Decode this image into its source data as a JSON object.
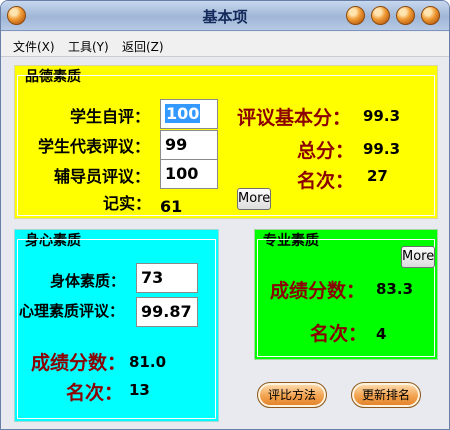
{
  "window": {
    "title": "基本项"
  },
  "menu": [
    {
      "label": "文件(X)"
    },
    {
      "label": "工具(Y)"
    },
    {
      "label": "返回(Z)"
    }
  ],
  "moral": {
    "title": "品德素质",
    "self_eval_label": "学生自评：",
    "self_eval_value": "100",
    "rep_eval_label": "学生代表评议：",
    "rep_eval_value": "99",
    "counselor_label": "辅导员评议：",
    "counselor_value": "100",
    "record_label": "记实：",
    "record_value": "61",
    "base_score_label": "评议基本分：",
    "base_score_value": "99.3",
    "total_label": "总分：",
    "total_value": "99.3",
    "rank_label": "名次：",
    "rank_value": "27",
    "more_label": "More"
  },
  "physical": {
    "title": "身心素质",
    "body_label": "身体素质：",
    "body_value": "73",
    "mental_label": "心理素质评议：",
    "mental_value": "99.87",
    "score_label": "成绩分数：",
    "score_value": "81.0",
    "rank_label": "名次：",
    "rank_value": "13"
  },
  "professional": {
    "title": "专业素质",
    "more_label": "More",
    "score_label": "成绩分数：",
    "score_value": "83.3",
    "rank_label": "名次：",
    "rank_value": "4"
  },
  "buttons": {
    "method_label": "评比方法",
    "update_label": "更新排名"
  },
  "colors": {
    "moral_bg": "#ffff00",
    "physical_bg": "#00ffff",
    "professional_bg": "#00ff00",
    "accent_text": "#8b0000"
  }
}
